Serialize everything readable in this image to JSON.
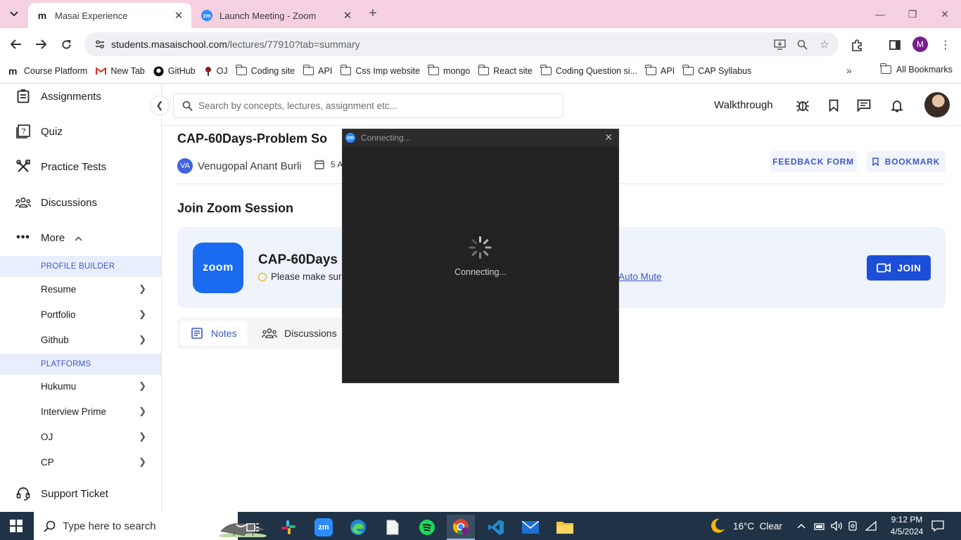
{
  "browser": {
    "tabs": [
      {
        "title": "Masai Experience",
        "favicon": "masai-m-icon",
        "active": true
      },
      {
        "title": "Launch Meeting - Zoom",
        "favicon": "zoom-icon",
        "active": false
      }
    ],
    "url_host": "students.masaischool.com",
    "url_path": "/lectures/77910?tab=summary",
    "profile_initial": "M",
    "bookmarks": [
      {
        "label": "Course Platform",
        "icon": "masai-m-icon"
      },
      {
        "label": "New Tab",
        "icon": "gmail-icon"
      },
      {
        "label": "GitHub",
        "icon": "github-icon"
      },
      {
        "label": "OJ",
        "icon": "oj-icon"
      },
      {
        "label": "Coding site",
        "icon": "folder-icon"
      },
      {
        "label": "API",
        "icon": "folder-icon"
      },
      {
        "label": "Css Imp website",
        "icon": "folder-icon"
      },
      {
        "label": "mongo",
        "icon": "folder-icon"
      },
      {
        "label": "React site",
        "icon": "folder-icon"
      },
      {
        "label": "Coding Question si...",
        "icon": "folder-icon"
      },
      {
        "label": "API",
        "icon": "folder-icon"
      },
      {
        "label": "CAP Syllabus",
        "icon": "folder-icon"
      }
    ],
    "all_bookmarks": "All Bookmarks"
  },
  "sidebar": {
    "main_items": [
      {
        "label": "Assignments",
        "icon": "assignment-icon"
      },
      {
        "label": "Quiz",
        "icon": "quiz-icon"
      },
      {
        "label": "Practice Tests",
        "icon": "tools-icon"
      },
      {
        "label": "Discussions",
        "icon": "people-icon"
      },
      {
        "label": "More",
        "icon": "more-dots-icon"
      }
    ],
    "section_profile": "PROFILE BUILDER",
    "profile_items": [
      "Resume",
      "Portfolio",
      "Github"
    ],
    "section_platforms": "PLATFORMS",
    "platform_items": [
      "Hukumu",
      "Interview Prime",
      "OJ",
      "CP"
    ],
    "support": "Support Ticket"
  },
  "header": {
    "search_placeholder": "Search by concepts, lectures, assignment etc...",
    "walkthrough": "Walkthrough"
  },
  "lecture": {
    "title": "CAP-60Days-Problem So",
    "instructor_initials": "VA",
    "instructor": "Venugopal Anant Burli",
    "date_partial": "5 A",
    "feedback_btn": "FEEDBACK FORM",
    "bookmark_btn": "BOOKMARK",
    "join_heading": "Join Zoom Session",
    "zoom_logo_text": "zoom",
    "zoom_session_title": "CAP-60Days",
    "zoom_note": "Please make sure",
    "auto_mute": "Auto Mute",
    "join_btn": "JOIN",
    "tabs": [
      {
        "label": "Notes",
        "active": true
      },
      {
        "label": "Discussions",
        "active": false
      }
    ]
  },
  "zoom_dialog": {
    "title": "Connecting...",
    "status": "Connecting..."
  },
  "taskbar": {
    "search_placeholder": "Type here to search",
    "apps": [
      "task-view-icon",
      "slack-icon",
      "zoom-icon",
      "edge-icon",
      "notepad-icon",
      "spotify-icon",
      "chrome-icon",
      "vscode-icon",
      "mail-icon",
      "file-explorer-icon"
    ],
    "weather": "16°C  Clear",
    "time": "9:12 PM",
    "date": "4/5/2024"
  },
  "colors": {
    "accent": "#3e58c8",
    "join_button": "#1d4ed8",
    "zoom_blue": "#1a6bf0",
    "tabstrip": "#f5d0e0",
    "taskbar": "#203245"
  }
}
